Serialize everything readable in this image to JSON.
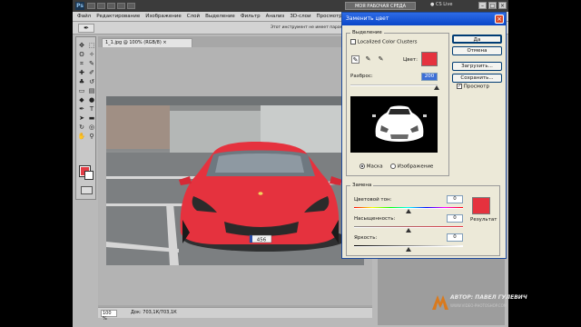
{
  "app": {
    "logo": "Ps",
    "workspace_button": "МОЯ РАБОЧАЯ СРЕДА",
    "cs_live": "CS Live"
  },
  "menu": [
    "Файл",
    "Редактирование",
    "Изображение",
    "Слой",
    "Выделение",
    "Фильтр",
    "Анализ",
    "3D-слои",
    "Просмотр"
  ],
  "options_bar": {
    "hint": "Этот инструмент не имеет параметров"
  },
  "document": {
    "tab_title": "1_1.jpg @ 100% (RGB/8)",
    "zoom": "100 %",
    "info": "Док: 703,1К/703,1К",
    "plate": "456"
  },
  "colors": {
    "foreground": "#e23c45",
    "background": "#ffffff",
    "swatch_red": "#e5323e",
    "title_bar": "#0a46c8"
  },
  "dialog": {
    "title": "Заменить цвет",
    "close": "×",
    "selection_group": "Выделение",
    "localized_label": "Localized Color Clusters",
    "color_label": "Цвет:",
    "fuzziness_label": "Разброс:",
    "fuzziness_value": "200",
    "mask_label": "Маска",
    "image_label": "Изображение",
    "replace_group": "Замена",
    "hue_label": "Цветовой тон:",
    "hue_value": "0",
    "sat_label": "Насыщенность:",
    "sat_value": "0",
    "light_label": "Яркость:",
    "light_value": "0",
    "result_label": "Результат",
    "ok": "Да",
    "cancel": "Отмена",
    "load": "Загрузить...",
    "save": "Сохранить...",
    "preview": "Просмотр"
  },
  "watermark": {
    "author": "АВТОР: ПАВЕЛ ГУЛЕВИЧ",
    "url": "WWW.VIDEO-PHOTOSHOP.COM"
  }
}
